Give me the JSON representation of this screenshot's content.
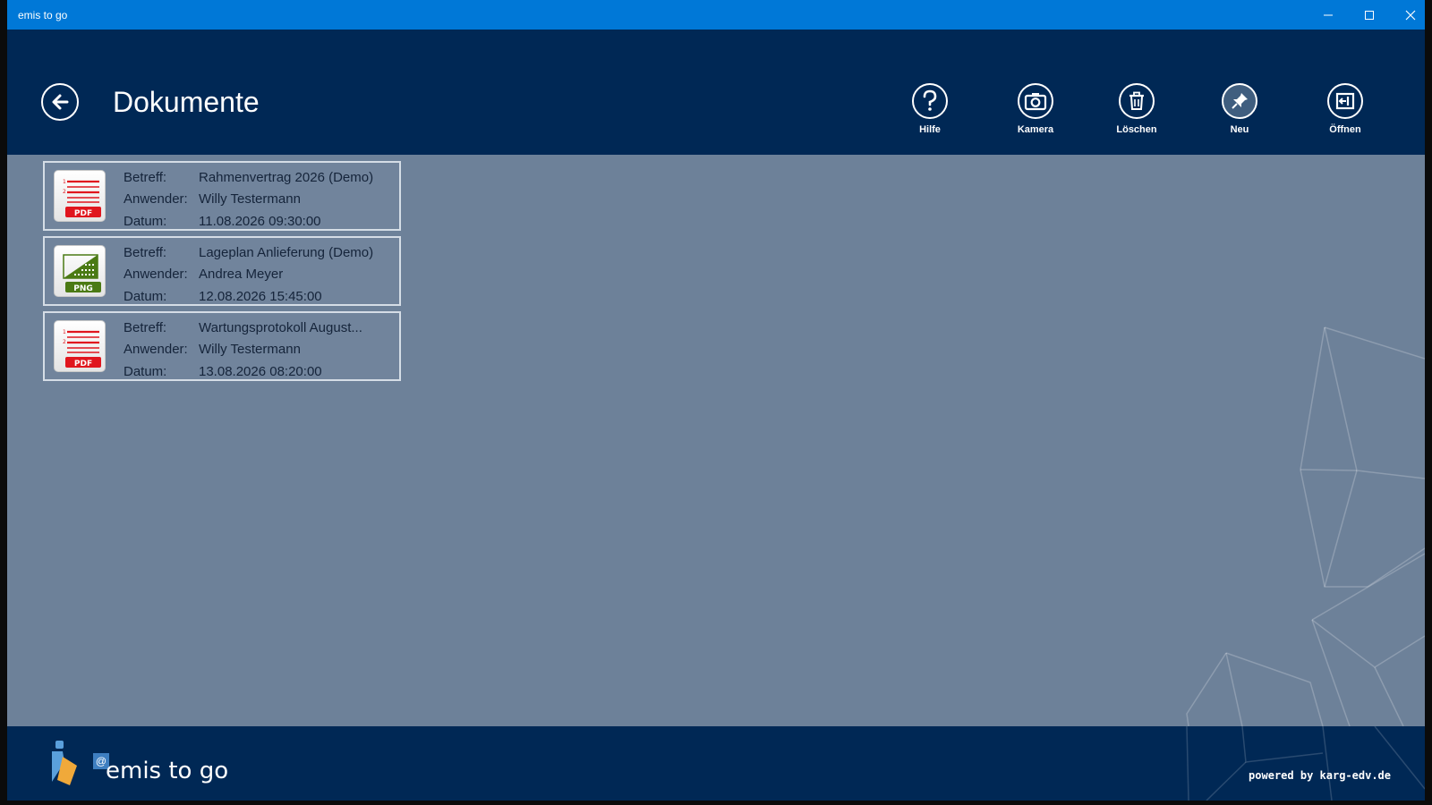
{
  "window": {
    "title": "emis to go"
  },
  "header": {
    "title": "Dokumente",
    "tools": [
      {
        "label": "Hilfe",
        "icon": "help-icon"
      },
      {
        "label": "Kamera",
        "icon": "camera-icon"
      },
      {
        "label": "Löschen",
        "icon": "trash-icon"
      },
      {
        "label": "Neu",
        "icon": "pin-icon"
      },
      {
        "label": "Öffnen",
        "icon": "open-icon"
      }
    ]
  },
  "labels": {
    "subject": "Betreff:",
    "user": "Anwender:",
    "date": "Datum:"
  },
  "documents": [
    {
      "type": "PDF",
      "subject": "Rahmenvertrag 2026 (Demo)",
      "user": "Willy Testermann",
      "date": "11.08.2026 09:30:00"
    },
    {
      "type": "PNG",
      "subject": "Lageplan Anlieferung (Demo)",
      "user": "Andrea Meyer",
      "date": "12.08.2026 15:45:00"
    },
    {
      "type": "PDF",
      "subject": "Wartungsprotokoll August...",
      "user": "Willy Testermann",
      "date": "13.08.2026 08:20:00"
    }
  ],
  "footer": {
    "brand": "emis to go",
    "powered": "powered by karg-edv.de"
  },
  "colors": {
    "titlebar": "#0078d7",
    "header": "#002855",
    "content": "#6d8199",
    "pdf_red": "#e0161e",
    "png_green": "#4b7a14"
  }
}
